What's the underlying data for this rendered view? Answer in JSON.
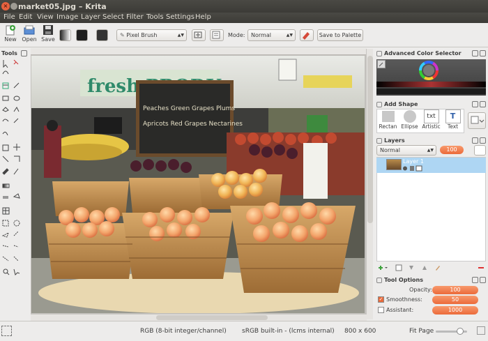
{
  "window": {
    "title": "market05.jpg – Krita"
  },
  "menu": [
    "File",
    "Edit",
    "View",
    "Image",
    "Layer",
    "Select",
    "Filter",
    "Tools",
    "Settings",
    "Help"
  ],
  "toolbar": {
    "new_label": "New",
    "open_label": "Open",
    "save_label": "Save",
    "brush_preset": "Pixel Brush",
    "mode_label": "Mode:",
    "blend_mode": "Normal",
    "save_to_palette": "Save to Palette"
  },
  "toolbox": {
    "title": "Tools"
  },
  "image": {
    "sign_text": "fresh PRODU",
    "chalk_line1": "Peaches  Green Grapes  Plums",
    "chalk_line2": "Apricots  Red Grapes  Nectarines"
  },
  "dockers": {
    "color_selector": {
      "title": "Advanced Color Selector"
    },
    "add_shape": {
      "title": "Add Shape",
      "shapes": [
        "Rectan",
        "Ellipse",
        "Artistic",
        "Text"
      ],
      "artistic_glyph": "txt",
      "text_glyph": "T"
    },
    "layers": {
      "title": "Layers",
      "blend_mode": "Normal",
      "opacity": "100",
      "layer_name": "Layer 1"
    },
    "tool_options": {
      "title": "Tool Options",
      "opacity_label": "Opacity:",
      "opacity_value": "100",
      "smoothness_label": "Smoothness:",
      "smoothness_value": "50",
      "smoothness_checked": true,
      "assistant_label": "Assistant:",
      "assistant_value": "1000",
      "assistant_checked": false
    }
  },
  "status": {
    "color_model": "RGB (8-bit integer/channel)",
    "profile": "sRGB built-in - (lcms internal)",
    "dimensions": "800 x 600",
    "zoom": "Fit Page"
  }
}
